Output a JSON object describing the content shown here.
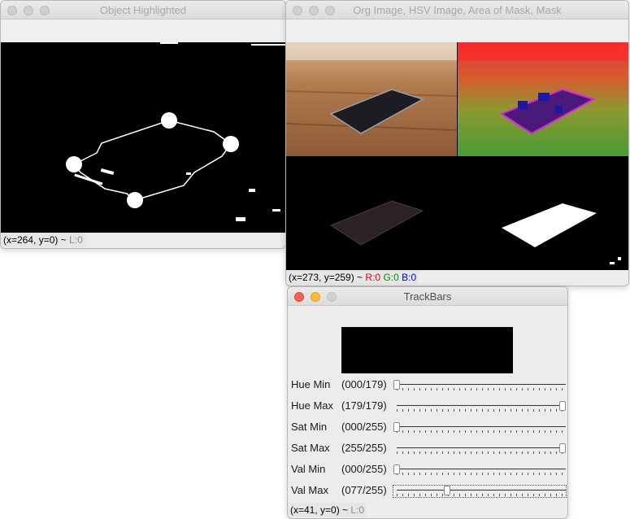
{
  "window_object": {
    "title": "Object Highlighted",
    "status": {
      "coords": "(x=264, y=0) ~",
      "level": "L:0"
    }
  },
  "window_images": {
    "title": "Org Image, HSV Image, Area of Mask, Mask",
    "status": {
      "coords": "(x=273, y=259) ~",
      "r": "R:0",
      "g": "G:0",
      "b": "B:0"
    }
  },
  "window_trackbars": {
    "title": "TrackBars",
    "sliders": [
      {
        "label": "Hue Min",
        "value": "(000/179)",
        "position": 0,
        "max": 179
      },
      {
        "label": "Hue Max",
        "value": "(179/179)",
        "position": 179,
        "max": 179
      },
      {
        "label": "Sat Min",
        "value": "(000/255)",
        "position": 0,
        "max": 255
      },
      {
        "label": "Sat Max",
        "value": "(255/255)",
        "position": 255,
        "max": 255
      },
      {
        "label": "Val Min",
        "value": "(000/255)",
        "position": 0,
        "max": 255
      },
      {
        "label": "Val Max",
        "value": "(077/255)",
        "position": 77,
        "max": 255
      }
    ],
    "status": {
      "coords": "(x=41, y=0) ~",
      "level": "L:0"
    }
  },
  "colors": {
    "close_active": "#fd5f57",
    "min_active": "#febc2e",
    "status_red": "#e00000",
    "status_green": "#009000",
    "status_blue": "#0000e0"
  }
}
